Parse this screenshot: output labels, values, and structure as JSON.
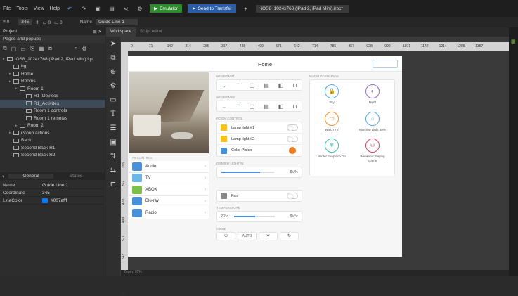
{
  "menu": [
    "File",
    "Tools",
    "View",
    "Help"
  ],
  "toolbar": {
    "emulator": "Emulator",
    "send": "Send to Transfer",
    "file_tab": "iOS8_1024x768 (iPad 2, iPad Mini).irpc*"
  },
  "propbar": {
    "value": "345",
    "name_label": "Name",
    "name_value": "Guide Line 1"
  },
  "project": {
    "title": "Project",
    "section": "Pages and popups",
    "tree": [
      {
        "label": "iOS8_1024x768 (iPad 2, iPad Mini).irpt",
        "indent": 0
      },
      {
        "label": "bg",
        "indent": 1
      },
      {
        "label": "Home",
        "indent": 1
      },
      {
        "label": "Rooms",
        "indent": 1
      },
      {
        "label": "Room 1",
        "indent": 2
      },
      {
        "label": "R1_Devices",
        "indent": 3
      },
      {
        "label": "R1_Activites",
        "indent": 3,
        "selected": true
      },
      {
        "label": "Room 1 controls",
        "indent": 3
      },
      {
        "label": "Room 1 remotes",
        "indent": 3
      },
      {
        "label": "Room 2",
        "indent": 2
      },
      {
        "label": "Group actions",
        "indent": 1
      },
      {
        "label": "Back",
        "indent": 1
      },
      {
        "label": "Second Back R1",
        "indent": 1
      },
      {
        "label": "Second Back R2",
        "indent": 1
      }
    ]
  },
  "props": {
    "tab_general": "General",
    "tab_states": "States",
    "rows": [
      {
        "k": "Name",
        "v": "Guide Line 1"
      },
      {
        "k": "Coordinate",
        "v": "345"
      },
      {
        "k": "LineColor",
        "v": "#007afff",
        "swatch": "#007aff"
      }
    ]
  },
  "editor_tabs": [
    "Workspace",
    "Script editor"
  ],
  "ruler": [
    "0",
    "71",
    "142",
    "214",
    "285",
    "357",
    "428",
    "499",
    "571",
    "642",
    "714",
    "785",
    "857",
    "928",
    "999",
    "1071",
    "1142",
    "1214",
    "1285",
    "1357"
  ],
  "ruler_v": [
    "286",
    "357",
    "428",
    "499",
    "571",
    "642",
    "714",
    "785"
  ],
  "device": {
    "title": "Home",
    "window1": "WINDOW #1",
    "window2": "WINDOW #2",
    "room_control": "ROOM CONTROL",
    "lamp1": "Lamp light #1",
    "lamp2": "Lamp light #2",
    "color_picker": "Color Picker",
    "dimmer": "DIMMER LIGHT #1",
    "dimmer_val": "$V%",
    "fan": "Fan",
    "temperature": "TEMPERATURE",
    "temp_min": "23°c",
    "temp_val": "$V°c",
    "mode": "MODE",
    "mode_auto": "AUTO",
    "av_control": "AV CONTROL",
    "av": [
      "Audio",
      "TV",
      "XBOX",
      "Blu-ray",
      "Radio"
    ],
    "av_colors": [
      "#4a90d9",
      "#6bb8e8",
      "#7cc04a",
      "#4a90d9",
      "#4a90d9"
    ],
    "scenarios_title": "ROOM SCENARIOS",
    "scenarios": [
      {
        "label": "Sky",
        "color": "#5aa9e0",
        "icon": "🔒"
      },
      {
        "label": "Night",
        "color": "#9a6bd1",
        "icon": "◐"
      },
      {
        "label": "Watch TV",
        "color": "#f0912f",
        "icon": "▭"
      },
      {
        "label": "Morning Light 40%",
        "color": "#5aa9e0",
        "icon": "☼"
      },
      {
        "label": "Winter Fireplace On",
        "color": "#3fb8b0",
        "icon": "❄"
      },
      {
        "label": "Weekend Playing Game",
        "color": "#d9456a",
        "icon": "⚇"
      }
    ],
    "accent": "#4a90d9",
    "picker_color": "#f07a1e"
  },
  "status": {
    "zoom": "Zoom: 70%"
  }
}
